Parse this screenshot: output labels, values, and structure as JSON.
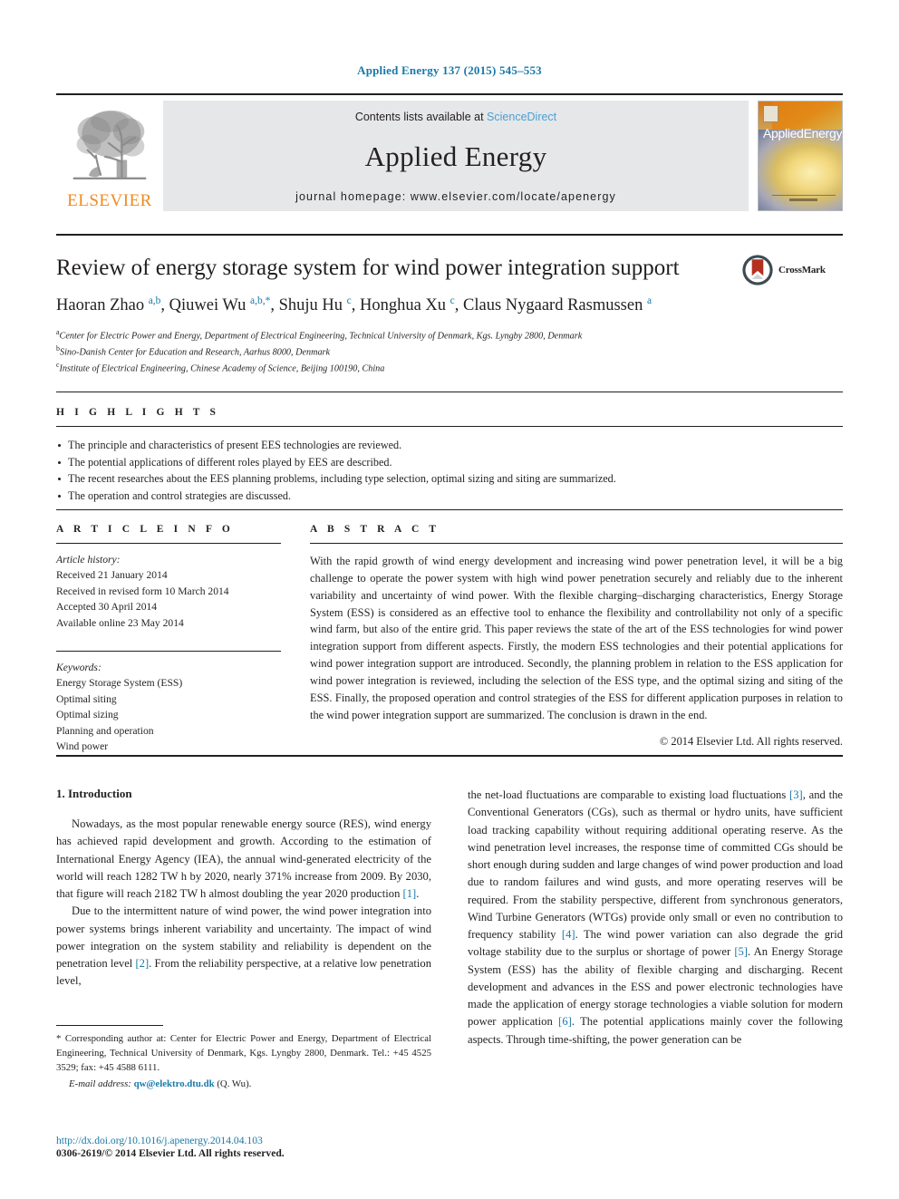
{
  "running_head": "Applied Energy 137 (2015) 545–553",
  "masthead": {
    "elsevier_wordmark": "ELSEVIER",
    "contents_prefix": "Contents lists available at",
    "sciencedirect": "ScienceDirect",
    "journal_name": "Applied Energy",
    "homepage": "journal homepage: www.elsevier.com/locate/apenergy",
    "cover_title_a": "Applied",
    "cover_title_b": "Energy"
  },
  "article": {
    "title": "Review of energy storage system for wind power integration support",
    "crossmark_label": "CrossMark",
    "authors_html": "Haoran Zhao <sup>a,b</sup>, Qiuwei Wu <sup>a,b,*</sup>, Shuju Hu <sup>c</sup>, Honghua Xu <sup>c</sup>, Claus Nygaard Rasmussen <sup>a</sup>",
    "affiliations": [
      {
        "marker": "a",
        "text": "Center for Electric Power and Energy, Department of Electrical Engineering, Technical University of Denmark, Kgs. Lyngby 2800, Denmark"
      },
      {
        "marker": "b",
        "text": "Sino-Danish Center for Education and Research, Aarhus 8000, Denmark"
      },
      {
        "marker": "c",
        "text": "Institute of Electrical Engineering, Chinese Academy of Science, Beijing 100190, China"
      }
    ]
  },
  "highlights": {
    "label": "H I G H L I G H T S",
    "items": [
      "The principle and characteristics of present EES technologies are reviewed.",
      "The potential applications of different roles played by EES are described.",
      "The recent researches about the EES planning problems, including type selection, optimal sizing and siting are summarized.",
      "The operation and control strategies are discussed."
    ]
  },
  "article_info": {
    "label": "A R T I C L E   I N F O",
    "history_label": "Article history:",
    "history": [
      "Received 21 January 2014",
      "Received in revised form 10 March 2014",
      "Accepted 30 April 2014",
      "Available online 23 May 2014"
    ],
    "keywords_label": "Keywords:",
    "keywords": [
      "Energy Storage System (ESS)",
      "Optimal siting",
      "Optimal sizing",
      "Planning and operation",
      "Wind power"
    ]
  },
  "abstract": {
    "label": "A B S T R A C T",
    "text": "With the rapid growth of wind energy development and increasing wind power penetration level, it will be a big challenge to operate the power system with high wind power penetration securely and reliably due to the inherent variability and uncertainty of wind power. With the flexible charging–discharging characteristics, Energy Storage System (ESS) is considered as an effective tool to enhance the flexibility and controllability not only of a specific wind farm, but also of the entire grid. This paper reviews the state of the art of the ESS technologies for wind power integration support from different aspects. Firstly, the modern ESS technologies and their potential applications for wind power integration support are introduced. Secondly, the planning problem in relation to the ESS application for wind power integration is reviewed, including the selection of the ESS type, and the optimal sizing and siting of the ESS. Finally, the proposed operation and control strategies of the ESS for different application purposes in relation to the wind power integration support are summarized. The conclusion is drawn in the end.",
    "copyright": "© 2014 Elsevier Ltd. All rights reserved."
  },
  "body": {
    "section_title": "1. Introduction",
    "left_para_1_html": "Nowadays, as the most popular renewable energy source (RES), wind energy has achieved rapid development and growth. According to the estimation of International Energy Agency (IEA), the annual wind-generated electricity of the world will reach 1282 TW h by 2020, nearly 371% increase from 2009. By 2030, that figure will reach 2182 TW h almost doubling the year 2020 production <span class=\"ref\">[1]</span>.",
    "left_para_2_html": "Due to the intermittent nature of wind power, the wind power integration into power systems brings inherent variability and uncertainty. The impact of wind power integration on the system stability and reliability is dependent on the penetration level <span class=\"ref\">[2]</span>. From the reliability perspective, at a relative low penetration level,",
    "right_para_html": "the net-load fluctuations are comparable to existing load fluctuations <span class=\"ref\">[3]</span>, and the Conventional Generators (CGs), such as thermal or hydro units, have sufficient load tracking capability without requiring additional operating reserve. As the wind penetration level increases, the response time of committed CGs should be short enough during sudden and large changes of wind power production and load due to random failures and wind gusts, and more operating reserves will be required. From the stability perspective, different from synchronous generators, Wind Turbine Generators (WTGs) provide only small or even no contribution to frequency stability <span class=\"ref\">[4]</span>. The wind power variation can also degrade the grid voltage stability due to the surplus or shortage of power <span class=\"ref\">[5]</span>. An Energy Storage System (ESS) has the ability of flexible charging and discharging. Recent development and advances in the ESS and power electronic technologies have made the application of energy storage technologies a viable solution for modern power application <span class=\"ref\">[6]</span>. The potential applications mainly cover the following aspects. Through time-shifting, the power generation can be"
  },
  "footnote": {
    "corresponding_html": "* Corresponding author at: Center for Electric Power and Energy, Department of Electrical Engineering, Technical University of Denmark, Kgs. Lyngby 2800, Denmark. Tel.: +45 4525 3529; fax: +45 4588 6111.",
    "email_label": "E-mail address:",
    "email": "qw@elektro.dtu.dk",
    "email_suffix": "(Q. Wu)."
  },
  "footer": {
    "doi": "http://dx.doi.org/10.1016/j.apenergy.2014.04.103",
    "copyright": "0306-2619/© 2014 Elsevier Ltd. All rights reserved."
  },
  "colors": {
    "link_blue": "#1878a8",
    "sciencedirect_blue": "#4a9fd5",
    "elsevier_orange": "#f08a1d",
    "masthead_gray": "#e6e7e8",
    "text": "#231f20"
  }
}
